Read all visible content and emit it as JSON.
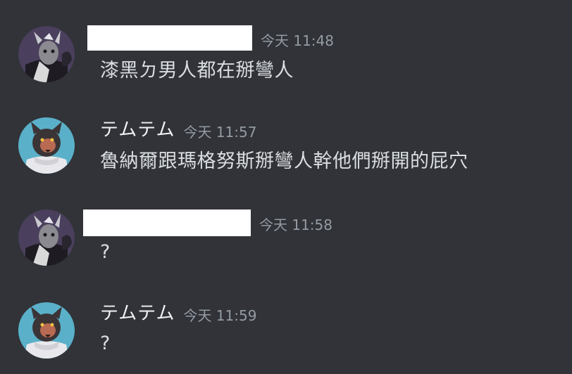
{
  "messages": [
    {
      "author": "",
      "author_redacted": true,
      "avatar_icon": "horned-demon-avatar-icon",
      "timestamp": "今天 11:48",
      "text": "漆黑ㄉ男人都在掰彎人"
    },
    {
      "author": "テムテム",
      "author_redacted": false,
      "avatar_icon": "wolf-avatar-icon",
      "timestamp": "今天 11:57",
      "text": "魯納爾跟瑪格努斯掰彎人幹他們掰開的屁穴"
    },
    {
      "author": "",
      "author_redacted": true,
      "avatar_icon": "horned-demon-avatar-icon",
      "timestamp": "今天 11:58",
      "text": "?"
    },
    {
      "author": "テムテム",
      "author_redacted": false,
      "avatar_icon": "wolf-avatar-icon",
      "timestamp": "今天 11:59",
      "text": "?"
    }
  ],
  "colors": {
    "background": "#313338",
    "username": "#f2f3f5",
    "timestamp": "#949ba4",
    "message_text": "#dbdee1",
    "redaction": "#ffffff"
  }
}
